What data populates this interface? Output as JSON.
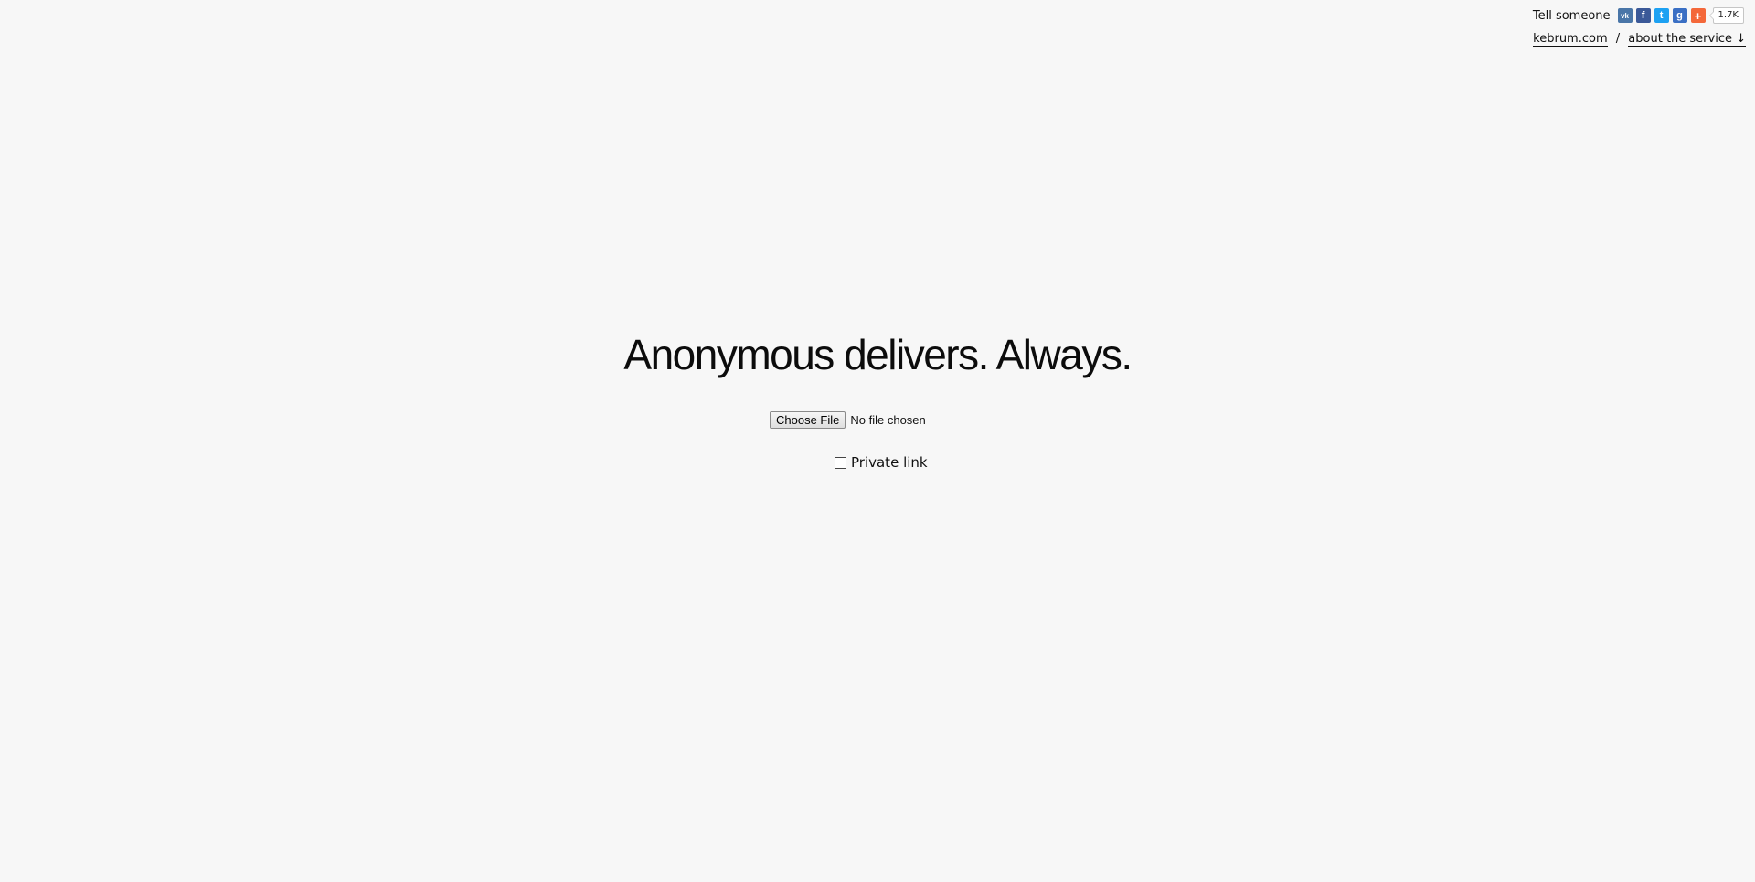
{
  "share": {
    "label": "Tell someone",
    "icons": [
      {
        "name": "vk-icon",
        "glyph": "vk"
      },
      {
        "name": "facebook-icon",
        "glyph": "f"
      },
      {
        "name": "twitter-icon",
        "glyph": "t"
      },
      {
        "name": "google-plus-icon",
        "glyph": "g"
      },
      {
        "name": "more-share-icon",
        "glyph": "+"
      }
    ],
    "counter": "1.7K"
  },
  "links": {
    "home": "kebrum.com",
    "separator": "/",
    "about": "about the service ↓"
  },
  "hero": {
    "title": "Anonymous delivers. Always."
  },
  "upload": {
    "button_label": "Choose File",
    "status": "No file chosen"
  },
  "options": {
    "private_link_label": "Private link",
    "private_link_checked": false
  },
  "colors": {
    "background": "#f7f7f7",
    "vk": "#4a76a8",
    "facebook": "#3b5998",
    "twitter": "#1da1f2",
    "google_plus": "#3a6fc4",
    "more": "#f4683a"
  }
}
